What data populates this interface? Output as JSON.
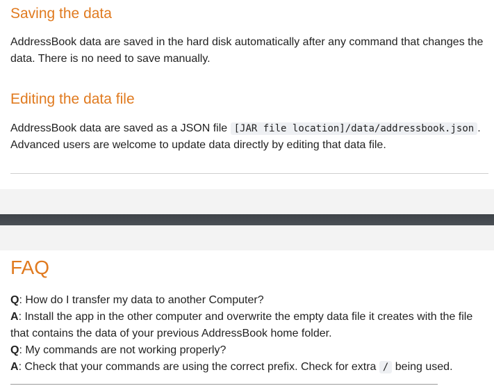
{
  "saving": {
    "heading": "Saving the data",
    "body": "AddressBook data are saved in the hard disk automatically after any command that changes the data. There is no need to save manually."
  },
  "editing": {
    "heading": "Editing the data file",
    "body_prefix": "AddressBook data are saved as a JSON file ",
    "code": "[JAR file location]/data/addressbook.json",
    "body_suffix": ". Advanced users are welcome to update data directly by editing that data file."
  },
  "faq": {
    "heading": "FAQ",
    "q_marker": "Q",
    "a_marker": "A",
    "items": [
      {
        "question": ": How do I transfer my data to another Computer?",
        "answer": ": Install the app in the other computer and overwrite the empty data file it creates with the file that contains the data of your previous AddressBook home folder."
      },
      {
        "question": ": My commands are not working properly?",
        "answer_prefix": ": Check that your commands are using the correct prefix. Check for extra ",
        "answer_code": "/",
        "answer_suffix": " being used."
      }
    ]
  }
}
